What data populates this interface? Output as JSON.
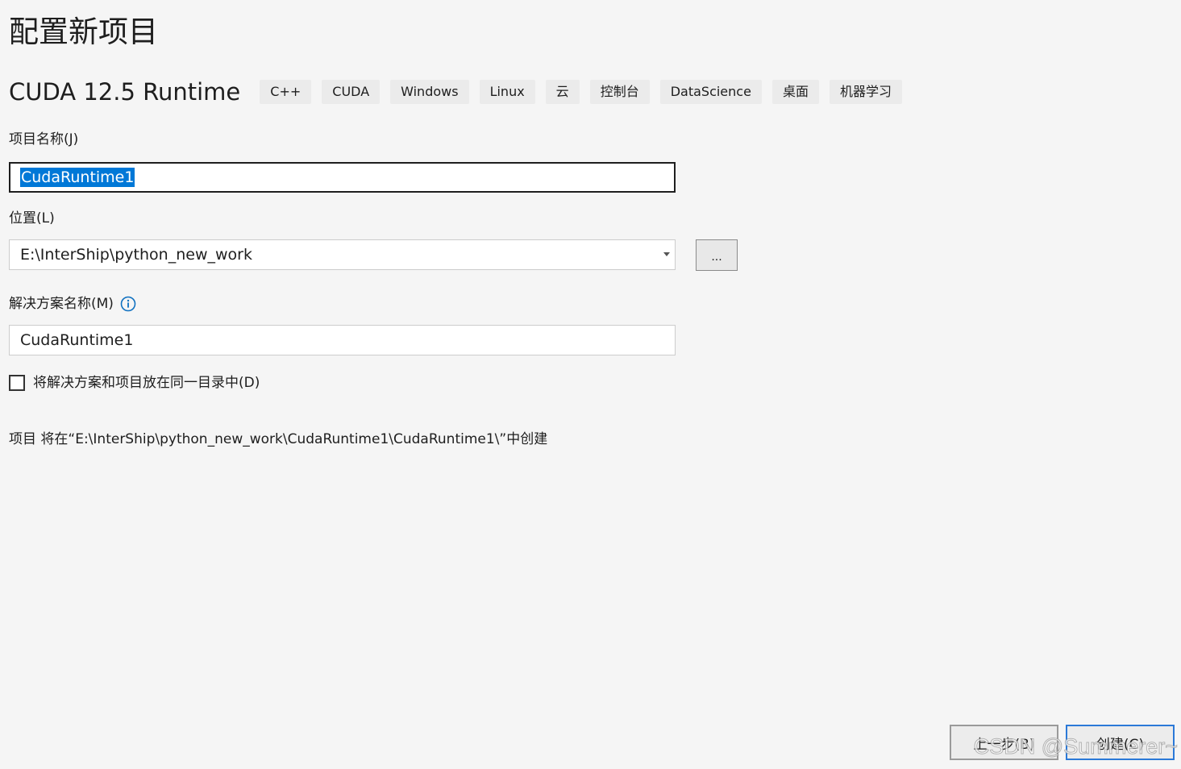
{
  "page": {
    "title": "配置新项目"
  },
  "template": {
    "name": "CUDA 12.5 Runtime",
    "tags": [
      "C++",
      "CUDA",
      "Windows",
      "Linux",
      "云",
      "控制台",
      "DataScience",
      "桌面",
      "机器学习"
    ]
  },
  "project_name": {
    "label": "项目名称(J)",
    "value": "CudaRuntime1"
  },
  "location": {
    "label": "位置(L)",
    "value": "E:\\InterShip\\python_new_work",
    "browse_label": "..."
  },
  "solution_name": {
    "label": "解决方案名称(M)",
    "value": "CudaRuntime1",
    "info_icon": "info-icon"
  },
  "same_directory": {
    "label": "将解决方案和项目放在同一目录中(D)",
    "checked": false
  },
  "path_preview": "项目 将在“E:\\InterShip\\python_new_work\\CudaRuntime1\\CudaRuntime1\\”中创建",
  "footer": {
    "back_label": "上一步(B)",
    "create_label": "创建(C)"
  },
  "watermark": "CSDN @Summerer~",
  "colors": {
    "background": "#f5f5f5",
    "selection": "#0078d7",
    "primary_border": "#2b79d8",
    "info": "#0e70c0"
  }
}
